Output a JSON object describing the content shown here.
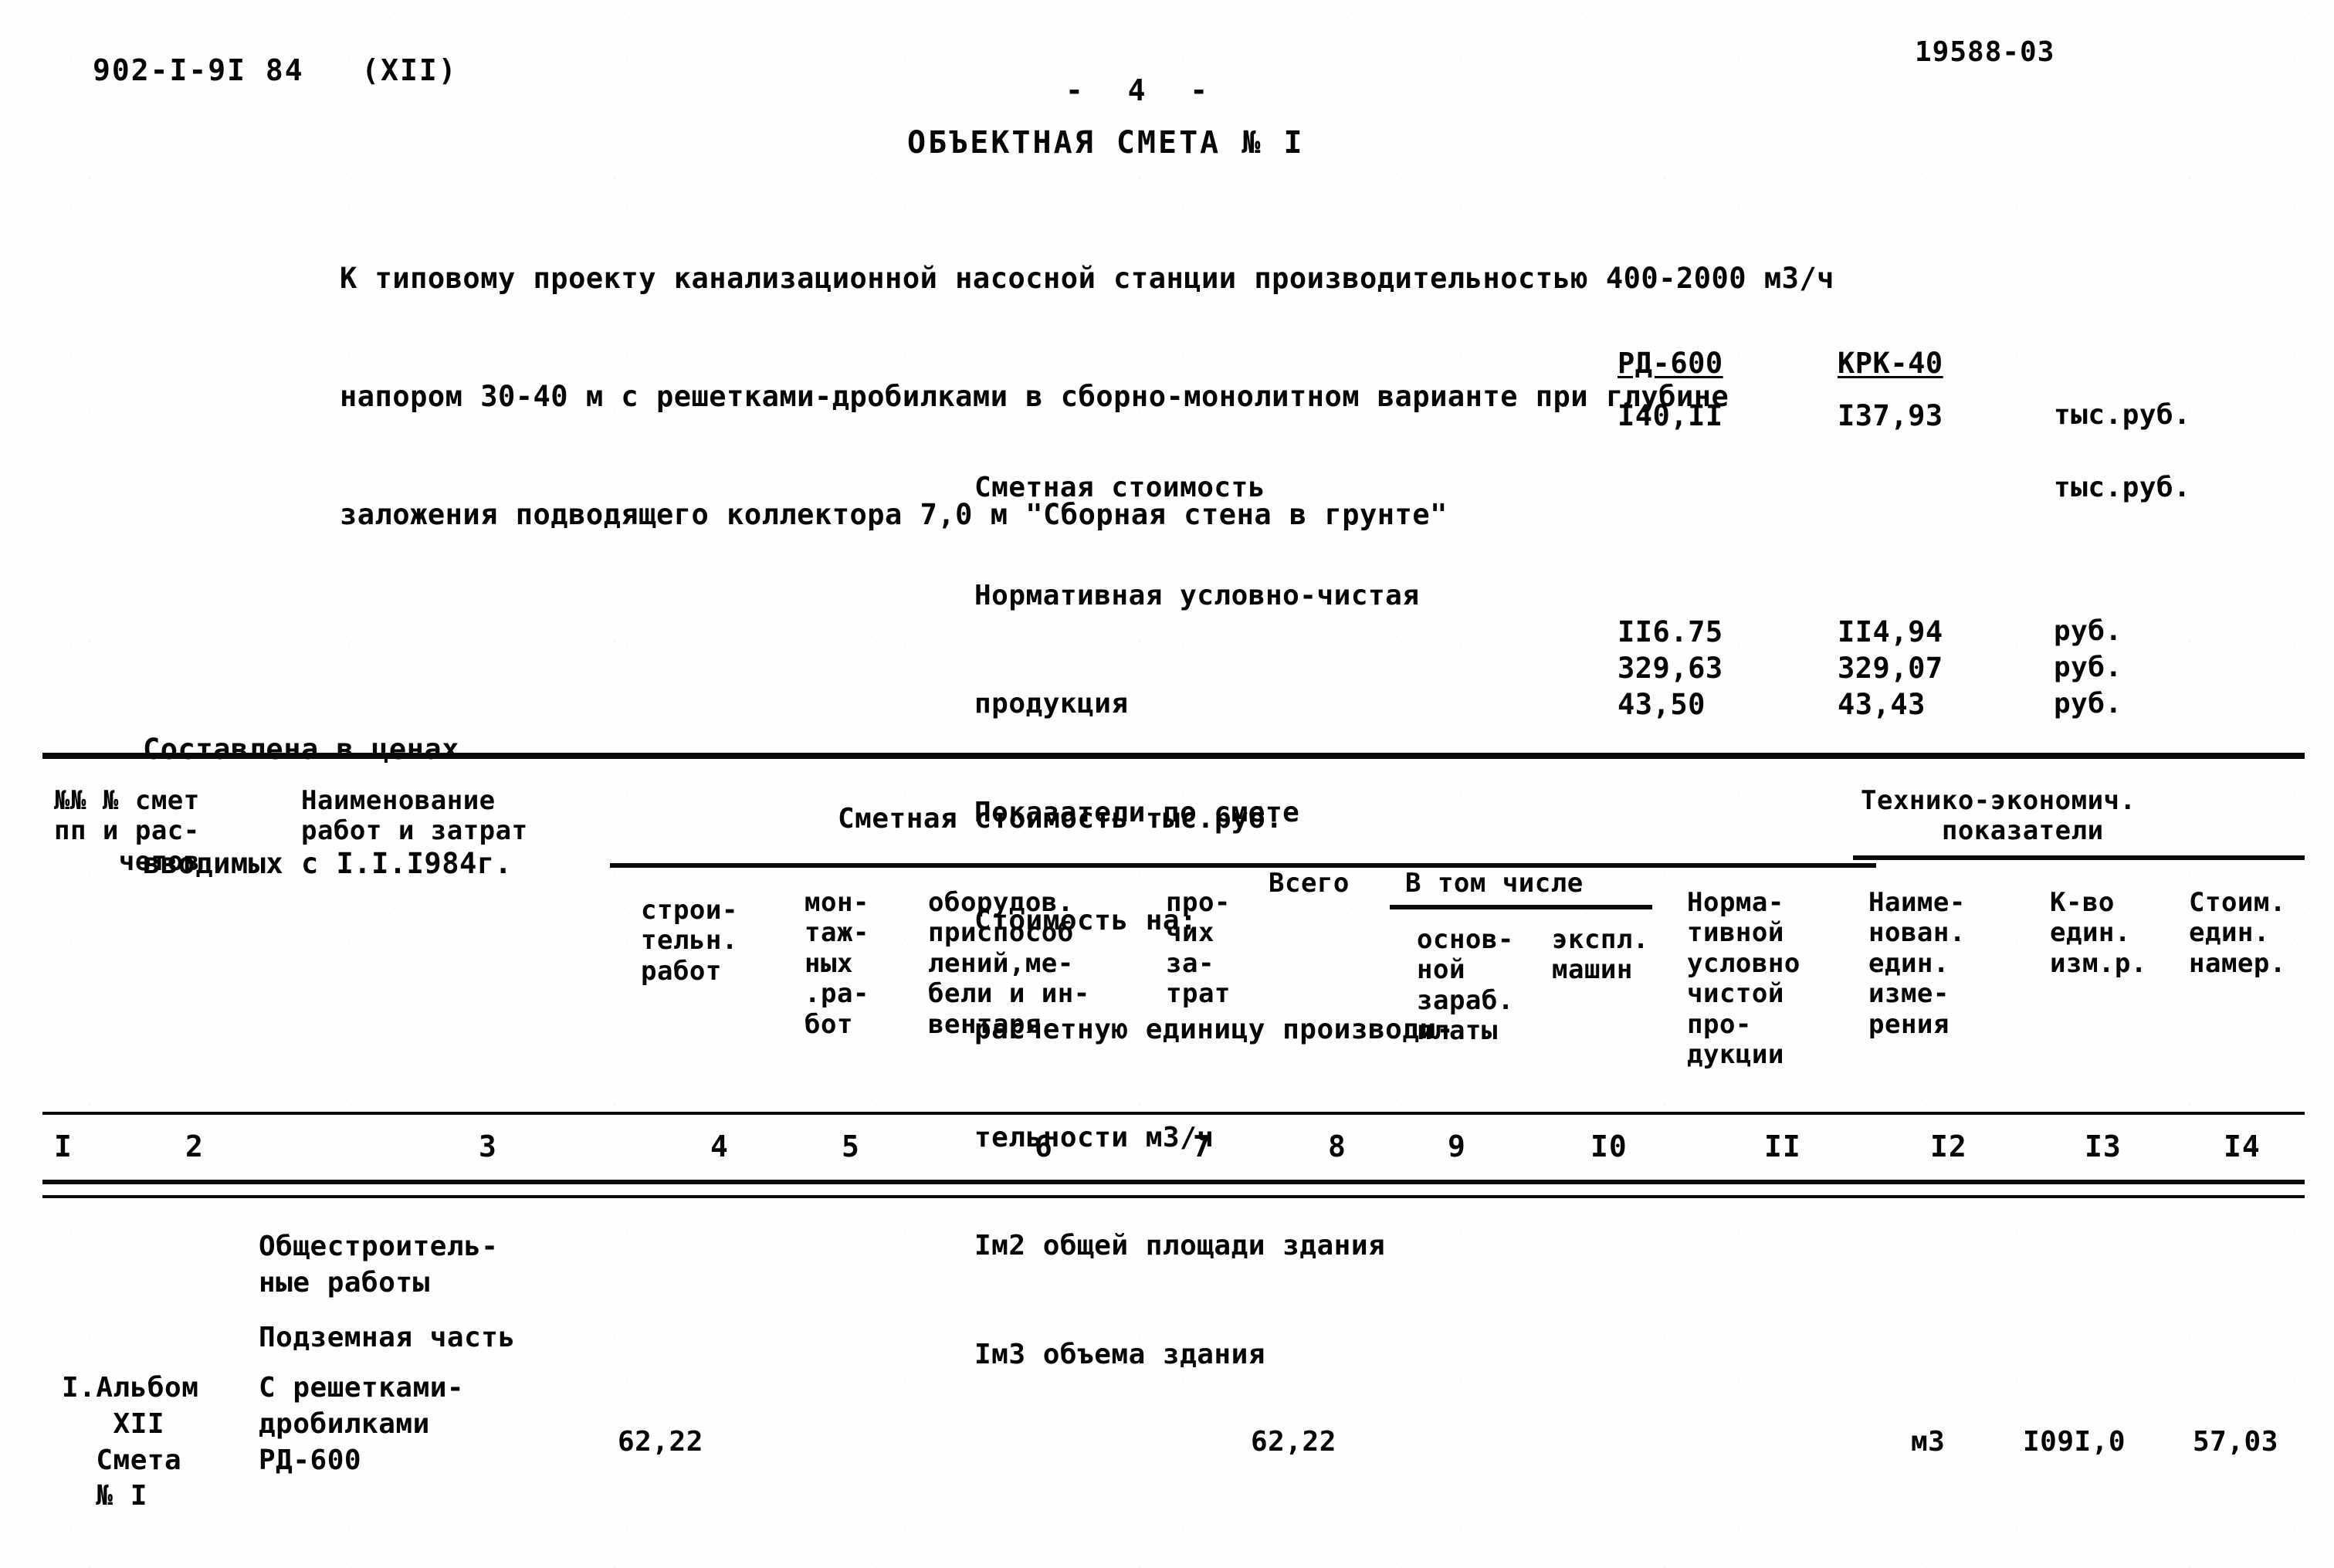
{
  "header": {
    "doc_code": "902-I-9I 84   (XII)",
    "sheet_code": "19588-03",
    "page_number": "-  4  -",
    "title": "ОБЪЕКТНАЯ СМЕТА № I"
  },
  "intro": {
    "line1": "К типовому проекту канализационной насосной станции производительностью 400-2000 м3/ч",
    "line2": "напором 30-40 м с решетками-дробилками в сборно-монолитном варианте при глубине",
    "line3": "заложения подводящего коллектора 7,0 м \"Сборная стена в грунте\""
  },
  "indicators": {
    "column_headers": [
      "РД-600",
      "КРК-40"
    ],
    "rows": [
      {
        "label": "Сметная стоимость",
        "value_1": "I40,II",
        "value_2": "I37,93",
        "unit": "тыс.руб."
      },
      {
        "label": "Нормативная условно-чистая",
        "value_1": "",
        "value_2": "",
        "unit": ""
      },
      {
        "label": "продукция",
        "value_1": "",
        "value_2": "",
        "unit": "тыс.руб."
      },
      {
        "label": "Показатели по смете",
        "value_1": "",
        "value_2": "",
        "unit": ""
      },
      {
        "label": "Стоимость на:",
        "value_1": "",
        "value_2": "",
        "unit": ""
      },
      {
        "label": "расчетную единицу производи-",
        "value_1": "",
        "value_2": "",
        "unit": ""
      },
      {
        "label": "тельности м3/ч",
        "value_1": "II6.75",
        "value_2": "II4,94",
        "unit": "руб."
      },
      {
        "label": "Iм2 общей площади здания",
        "value_1": "329,63",
        "value_2": "329,07",
        "unit": "руб."
      },
      {
        "label": "Iм3 объема здания",
        "value_1": "43,50",
        "value_2": "43,43",
        "unit": "руб."
      }
    ]
  },
  "prices_note": {
    "line1": "Составлена в ценах",
    "line2": "вводимых с I.I.I984г."
  },
  "table": {
    "header": {
      "col1": "№№ № смет\nпп и рас-\n    четов",
      "col2": "Наименование\nработ и затрат",
      "group_cost": "Сметная стоимость тыс.руб.",
      "group_tech": "Технико-экономич.\n     показатели",
      "col4": "строи-\nтельн.\nработ",
      "col5": "мон-\nтаж-\nных\n.ра-\nбот",
      "col6": "оборудов.\nприспособ\nлений,ме-\nбели и ин-\nвентаря",
      "col7": "про-\nчих\nза-\nтрат",
      "col8": "Всего",
      "col9_10_group": "В том числе",
      "col9": "основ-\nной\nзараб.\nплаты",
      "col10": "экспл.\nмашин",
      "col11": "Норма-\nтивной\nусловно\nчистой\nпро-\nдукции",
      "col12": "Наиме-\nнован.\nедин.\nизме-\nрения",
      "col13": "К-во\nедин.\nизм.р.",
      "col14": "Стоим.\nедин.\nнамер."
    },
    "column_numbers": [
      "I",
      "2",
      "3",
      "4",
      "5",
      "6",
      "7",
      "8",
      "9",
      "I0",
      "II",
      "I2",
      "I3",
      "I4"
    ],
    "body": {
      "group_title": "Общестроитель-\nные работы",
      "subgroup_title": "Подземная часть",
      "row_ref": "I.Альбом\n   XII\n  Смета\n  № I",
      "row_name": "С решетками-\nдробилками\nРД-600",
      "constr_works": "62,22",
      "total": "62,22",
      "tech_unit": "м3",
      "tech_qty": "I09I,0",
      "tech_unit_cost": "57,03"
    }
  }
}
